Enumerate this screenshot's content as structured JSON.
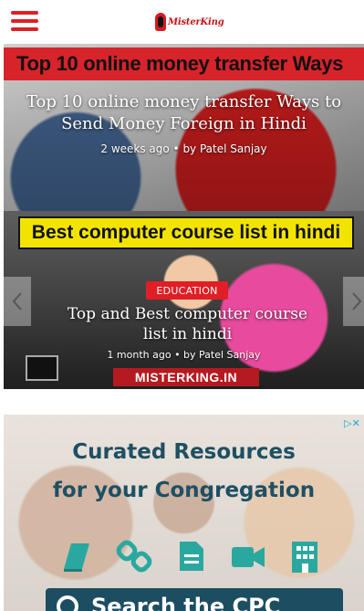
{
  "header": {
    "logo_text": "MisterKing",
    "menu_icon": "hamburger-menu-icon",
    "accent_color": "#e01e25"
  },
  "slider": {
    "slides": [
      {
        "banner": "Top 10 online money transfer Ways",
        "title": "Top 10 online money transfer Ways to Send Money Foreign in Hindi",
        "meta": "2 weeks ago • by Patel Sanjay"
      },
      {
        "banner": "Best computer course list in hindi",
        "category": "EDUCATION",
        "title": "Top and Best computer course list in hindi",
        "meta": "1 month ago • by Patel Sanjay",
        "watermark": "MISTERKING.IN"
      }
    ],
    "prev_icon": "chevron-left-icon",
    "next_icon": "chevron-right-icon"
  },
  "ad": {
    "choices_icon": "ad-choices-icon",
    "headline_1": "Curated Resources",
    "headline_2": "for your Congregation",
    "search_label": "Search the CPC",
    "icons": [
      "book-icon",
      "link-icon",
      "document-icon",
      "video-icon",
      "building-icon"
    ],
    "accent_color": "#1e4f63",
    "icon_color": "#2aa8a0"
  }
}
